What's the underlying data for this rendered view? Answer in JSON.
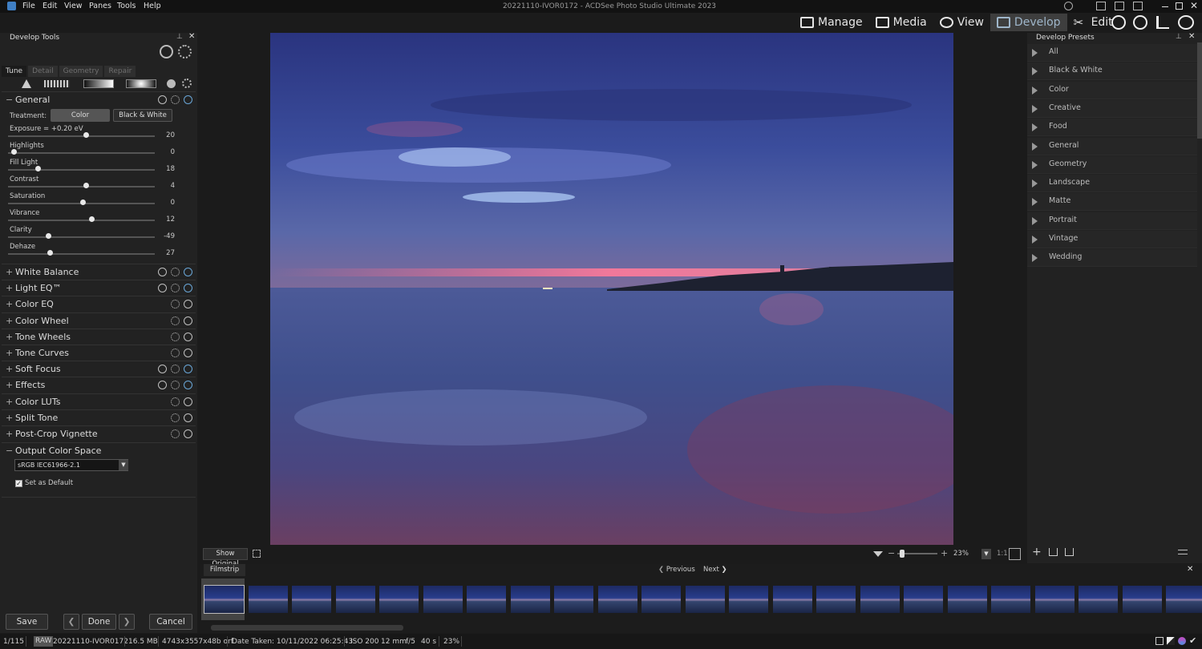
{
  "window": {
    "title": "20221110-IVOR0172 - ACDSee Photo Studio Ultimate 2023"
  },
  "menu": [
    "File",
    "Edit",
    "View",
    "Panes",
    "Tools",
    "Help"
  ],
  "modes": [
    {
      "label": "Manage"
    },
    {
      "label": "Media"
    },
    {
      "label": "View"
    },
    {
      "label": "Develop"
    },
    {
      "label": "Edit"
    }
  ],
  "left_panel": {
    "title": "Develop Tools",
    "tabs": [
      "Tune",
      "Detail",
      "Geometry",
      "Repair"
    ],
    "general": {
      "label": "General",
      "treatment_label": "Treatment:",
      "treatment_options": [
        "Color",
        "Black & White"
      ],
      "treatment_selected": "Color",
      "sliders": [
        {
          "label": "Exposure = +0.20 eV",
          "value": "20",
          "level": 0.52
        },
        {
          "label": "Highlights",
          "value": "0",
          "level": 0.02
        },
        {
          "label": "Fill Light",
          "value": "18",
          "level": 0.19
        },
        {
          "label": "Contrast",
          "value": "4",
          "level": 0.52
        },
        {
          "label": "Saturation",
          "value": "0",
          "level": 0.5
        },
        {
          "label": "Vibrance",
          "value": "12",
          "level": 0.56
        },
        {
          "label": "Clarity",
          "value": "-49",
          "level": 0.26
        },
        {
          "label": "Dehaze",
          "value": "27",
          "level": 0.27
        }
      ]
    },
    "sections": [
      {
        "label": "White Balance",
        "reset": true,
        "enabled": true
      },
      {
        "label": "Light EQ™",
        "reset": true,
        "enabled": true
      },
      {
        "label": "Color EQ",
        "reset": false,
        "enabled": false
      },
      {
        "label": "Color Wheel",
        "reset": false,
        "enabled": false
      },
      {
        "label": "Tone Wheels",
        "reset": false,
        "enabled": false
      },
      {
        "label": "Tone Curves",
        "reset": false,
        "enabled": false
      },
      {
        "label": "Soft Focus",
        "reset": true,
        "enabled": true
      },
      {
        "label": "Effects",
        "reset": true,
        "enabled": true
      },
      {
        "label": "Color LUTs",
        "reset": false,
        "enabled": false
      },
      {
        "label": "Split Tone",
        "reset": false,
        "enabled": false
      },
      {
        "label": "Post-Crop Vignette",
        "reset": false,
        "enabled": false
      }
    ],
    "output": {
      "label": "Output Color Space",
      "profile": "sRGB IEC61966-2.1",
      "default_label": "Set as Default",
      "default_checked": true
    },
    "buttons": {
      "save": "Save",
      "done": "Done",
      "cancel": "Cancel"
    }
  },
  "right_panel": {
    "title": "Develop Presets",
    "presets": [
      "All",
      "Black & White",
      "Color",
      "Creative",
      "Food",
      "General",
      "Geometry",
      "Landscape",
      "Matte",
      "Portrait",
      "Vintage",
      "Wedding"
    ]
  },
  "image_toolbar": {
    "show_original": "Show Original",
    "zoom": "23%",
    "ratio": "1:1"
  },
  "filmstrip": {
    "title": "Filmstrip",
    "previous": "Previous",
    "next": "Next",
    "thumb_count": 23
  },
  "status": {
    "position": "1/115",
    "format": "RAW",
    "filename": "20221110-IVOR0172",
    "size": "16.5 MB",
    "dimensions": "4743x3557x48b orf",
    "date": "Date Taken: 10/11/2022 06:25:43",
    "iso": "ISO 200",
    "focal": "12 mm",
    "aperture": "f/5",
    "shutter": "40 s",
    "zoom": "23%"
  },
  "colors": {
    "accent": "#6aa7d8",
    "panel": "#222222",
    "background": "#1b1b1b"
  }
}
